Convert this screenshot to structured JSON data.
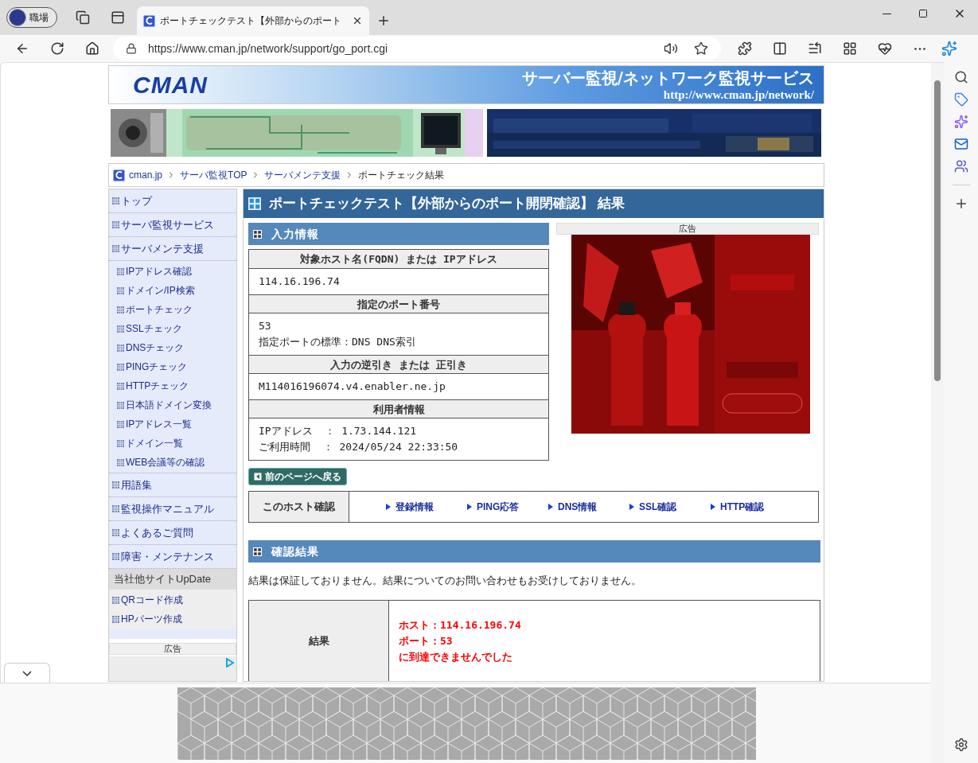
{
  "browser": {
    "profile": "職場",
    "tabs": [
      {
        "title": "ポートチェックテスト【外部からのポート",
        "selected": true
      }
    ],
    "url": "https://www.cman.jp/network/support/go_port.cgi"
  },
  "header": {
    "logo": "CMAN",
    "title": "サーバー監視/ネットワーク監視サービス",
    "url": "http://www.cman.jp/network/"
  },
  "breadcrumb": [
    {
      "label": "cman.jp",
      "kind": "link"
    },
    {
      "label": "サーバ監視TOP",
      "kind": "link"
    },
    {
      "label": "サーバメンテ支援",
      "kind": "link"
    },
    {
      "label": "ポートチェック結果",
      "kind": "text"
    }
  ],
  "sidebar": {
    "items": [
      {
        "label": "トップ"
      },
      {
        "label": "サーバ監視サービス"
      },
      {
        "label": "サーバメンテ支援",
        "children": [
          {
            "label": "IPアドレス確認"
          },
          {
            "label": "ドメイン/IP検索"
          },
          {
            "label": "ポートチェック"
          },
          {
            "label": "SSLチェック"
          },
          {
            "label": "DNSチェック"
          },
          {
            "label": "PINGチェック"
          },
          {
            "label": "HTTPチェック"
          },
          {
            "label": "日本語ドメイン変換"
          },
          {
            "label": "IPアドレス一覧"
          },
          {
            "label": "ドメイン一覧"
          },
          {
            "label": "WEB会議等の確認"
          }
        ]
      },
      {
        "label": "用語集"
      },
      {
        "label": "監視操作マニュアル"
      },
      {
        "label": "よくあるご質問"
      },
      {
        "label": "障害・メンテナンス"
      }
    ],
    "sister_heading": "当社他サイトUpDate",
    "sister_items": [
      {
        "label": "QRコード作成"
      },
      {
        "label": "HPパーツ作成"
      }
    ],
    "ad_label": "広告"
  },
  "main": {
    "title": "ポートチェックテスト【外部からのポート開閉確認】 結果",
    "input": {
      "heading": "入力情報",
      "fields": [
        {
          "label": "対象ホスト名(FQDN) または IPアドレス",
          "lines": [
            "114.16.196.74"
          ]
        },
        {
          "label": "指定のポート番号",
          "lines": [
            "53",
            "指定ポートの標準：DNS DNS索引"
          ]
        },
        {
          "label": "入力の逆引き または 正引き",
          "lines": [
            "M114016196074.v4.enabler.ne.jp"
          ]
        },
        {
          "label": "利用者情報",
          "lines": [
            "IPアドレス  ： 1.73.144.121",
            "ご利用時間  ： 2024/05/24 22:33:50"
          ]
        }
      ]
    },
    "ad_label": "広告",
    "back_button": "前のページへ戻る",
    "host_check": {
      "label": "このホスト確認",
      "links": [
        "登録情報",
        "PING応答",
        "DNS情報",
        "SSL確認",
        "HTTP確認"
      ]
    },
    "result": {
      "heading": "確認結果",
      "notice": "結果は保証しておりません。結果についてのお問い合わせもお受けしておりません。",
      "label": "結果",
      "lines": [
        "ホスト：114.16.196.74",
        "ポート：53",
        "に到達できませんでした"
      ]
    }
  }
}
